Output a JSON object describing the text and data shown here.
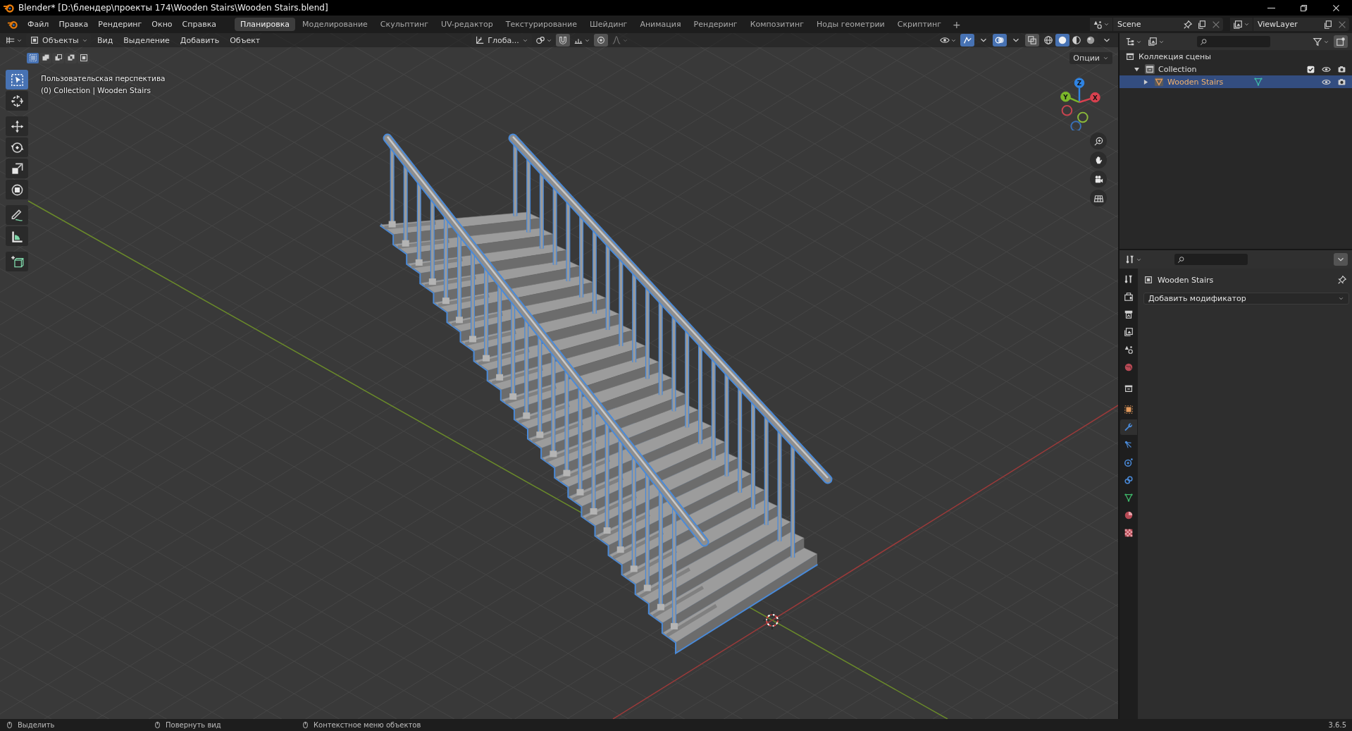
{
  "title_bar": {
    "title": "Blender* [D:\\блендер\\проекты 174\\Wooden Stairs\\Wooden Stairs.blend]"
  },
  "top_bar": {
    "menus": [
      "Файл",
      "Правка",
      "Рендеринг",
      "Окно",
      "Справка"
    ],
    "workspaces": [
      {
        "label": "Планировка",
        "selected": true
      },
      {
        "label": "Моделирование",
        "selected": false
      },
      {
        "label": "Скульптинг",
        "selected": false
      },
      {
        "label": "UV-редактор",
        "selected": false
      },
      {
        "label": "Текстурирование",
        "selected": false
      },
      {
        "label": "Шейдинг",
        "selected": false
      },
      {
        "label": "Анимация",
        "selected": false
      },
      {
        "label": "Рендеринг",
        "selected": false
      },
      {
        "label": "Композитинг",
        "selected": false
      },
      {
        "label": "Ноды геометрии",
        "selected": false
      },
      {
        "label": "Скриптинг",
        "selected": false
      }
    ],
    "add_workspace": "+",
    "scene": "Scene",
    "view_layer": "ViewLayer"
  },
  "viewport": {
    "header": {
      "mode": "Объекты",
      "menus": [
        "Вид",
        "Выделение",
        "Добавить",
        "Объект"
      ],
      "orientation": "Глоба...",
      "shading": [
        {
          "kind": "wireframe",
          "selected": false
        },
        {
          "kind": "solid",
          "selected": true
        },
        {
          "kind": "material",
          "selected": false
        },
        {
          "kind": "rendered",
          "selected": false
        }
      ],
      "options": "Опции"
    },
    "select_modes": [
      {
        "kind": "set",
        "selected": true
      },
      {
        "kind": "extend",
        "selected": false
      },
      {
        "kind": "subtract",
        "selected": false
      },
      {
        "kind": "invert",
        "selected": false
      },
      {
        "kind": "intersect",
        "selected": false
      }
    ],
    "overlay": {
      "view_name": "Пользовательская перспектива",
      "object_info": "(0) Collection | Wooden Stairs"
    },
    "tools": [
      {
        "kind": "select_box",
        "selected": true
      },
      {
        "kind": "cursor",
        "selected": false
      },
      {
        "kind": "move",
        "selected": false
      },
      {
        "kind": "rotate",
        "selected": false
      },
      {
        "kind": "scale",
        "selected": false
      },
      {
        "kind": "transform",
        "selected": false
      },
      {
        "kind": "annotate",
        "selected": false
      },
      {
        "kind": "measure",
        "selected": false
      },
      {
        "kind": "add_cube",
        "selected": false
      }
    ],
    "gizmo": {
      "x": "X",
      "y": "Y",
      "z": "Z"
    },
    "nav_buttons": [
      {
        "kind": "zoom"
      },
      {
        "kind": "pan"
      },
      {
        "kind": "camera"
      },
      {
        "kind": "ortho"
      }
    ]
  },
  "outliner": {
    "rows": [
      {
        "label": "Коллекция сцены",
        "kind": "scene_collection",
        "selected": false,
        "children": [
          {
            "label": "Collection",
            "kind": "collection",
            "expanded": true,
            "selected": false,
            "children": [
              {
                "label": "Wooden Stairs",
                "kind": "mesh_object",
                "expanded": false,
                "selected": true
              }
            ]
          }
        ]
      }
    ]
  },
  "properties": {
    "tabs": [
      {
        "kind": "tool",
        "selected": false
      },
      {
        "kind": "render",
        "selected": false
      },
      {
        "kind": "output",
        "selected": false
      },
      {
        "kind": "view_layer",
        "selected": false
      },
      {
        "kind": "scene",
        "selected": false
      },
      {
        "kind": "world",
        "selected": false
      },
      {
        "kind": "collection",
        "selected": false
      },
      {
        "kind": "object",
        "selected": false
      },
      {
        "kind": "modifier",
        "selected": true
      },
      {
        "kind": "particles",
        "selected": false
      },
      {
        "kind": "physics",
        "selected": false
      },
      {
        "kind": "constraints",
        "selected": false
      },
      {
        "kind": "data",
        "selected": false
      },
      {
        "kind": "material",
        "selected": false
      },
      {
        "kind": "texture",
        "selected": false
      }
    ],
    "object_name": "Wooden Stairs",
    "add_modifier": "Добавить модификатор"
  },
  "status_bar": {
    "hints": [
      {
        "label": "Выделить"
      },
      {
        "label": "Повернуть вид"
      },
      {
        "label": "Контекстное меню объектов"
      }
    ],
    "version": "3.6.5"
  }
}
